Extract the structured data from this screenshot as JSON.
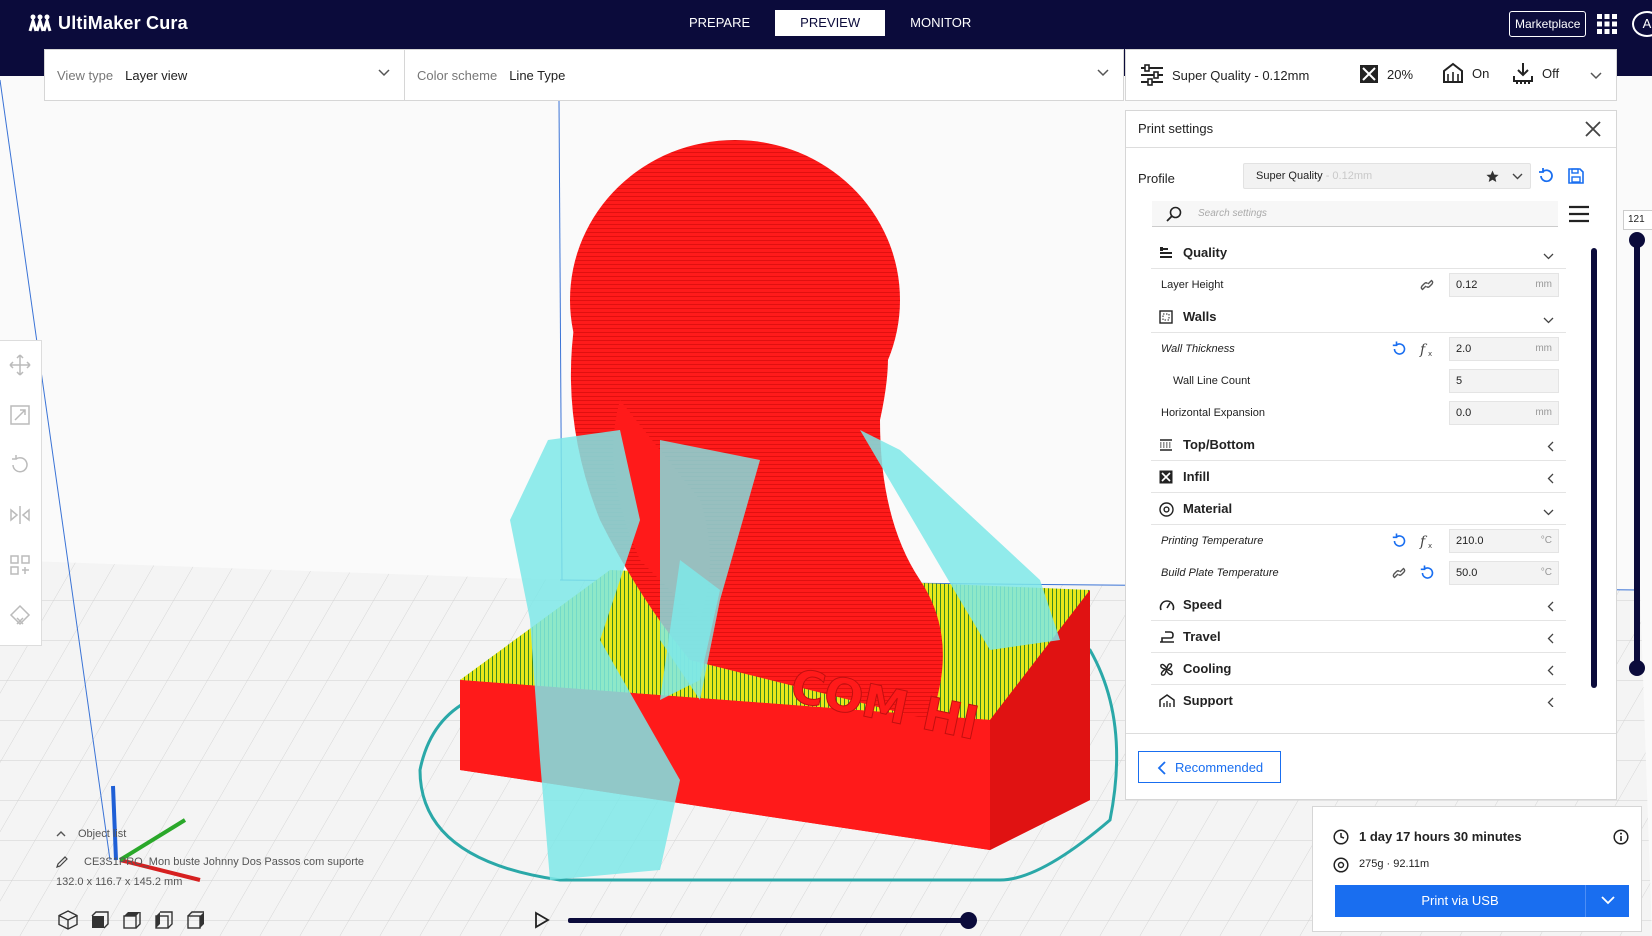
{
  "header": {
    "app_title": "UltiMaker Cura",
    "stages": [
      {
        "label": "PREPARE",
        "active": false
      },
      {
        "label": "PREVIEW",
        "active": true
      },
      {
        "label": "MONITOR",
        "active": false
      }
    ],
    "marketplace_label": "Marketplace",
    "account_initial": "A"
  },
  "viewbar": {
    "view_type_label": "View type",
    "view_type_value": "Layer view",
    "color_scheme_label": "Color scheme",
    "color_scheme_value": "Line Type"
  },
  "printbar": {
    "profile": "Super Quality - 0.12mm",
    "infill": "20%",
    "support": "On",
    "adhesion": "Off"
  },
  "objects": {
    "header": "Object list",
    "item_name": "CE3S1PRO_Mon buste Johnny Dos Passos com suporte",
    "dimensions": "132.0 x 116.7 x 145.2 mm"
  },
  "layer_slider": {
    "current_layer_label": "121"
  },
  "print_settings": {
    "title": "Print settings",
    "profile_label": "Profile",
    "profile_name": "Super Quality",
    "profile_suffix": " - 0.12mm",
    "search_placeholder": "Search settings",
    "rows": [
      {
        "kind": "category",
        "label": "Quality",
        "icon": "quality-icon",
        "expanded": true
      },
      {
        "kind": "setting",
        "label": "Layer Height",
        "value": "0.12",
        "unit": "mm",
        "italic": false,
        "indent": false,
        "icons": [
          "link-icon"
        ]
      },
      {
        "kind": "category",
        "label": "Walls",
        "icon": "walls-icon",
        "expanded": true
      },
      {
        "kind": "setting",
        "label": "Wall Thickness",
        "value": "2.0",
        "unit": "mm",
        "italic": true,
        "indent": false,
        "icons": [
          "function-icon",
          "reset-icon"
        ]
      },
      {
        "kind": "setting",
        "label": "Wall Line Count",
        "value": "5",
        "unit": "",
        "italic": false,
        "indent": true,
        "icons": []
      },
      {
        "kind": "setting",
        "label": "Horizontal Expansion",
        "value": "0.0",
        "unit": "mm",
        "italic": false,
        "indent": false,
        "icons": []
      },
      {
        "kind": "category",
        "label": "Top/Bottom",
        "icon": "top-bottom-icon",
        "expanded": false
      },
      {
        "kind": "category",
        "label": "Infill",
        "icon": "infill-icon",
        "expanded": false
      },
      {
        "kind": "category",
        "label": "Material",
        "icon": "material-icon",
        "expanded": true
      },
      {
        "kind": "setting",
        "label": "Printing Temperature",
        "value": "210.0",
        "unit": "°C",
        "italic": true,
        "indent": false,
        "icons": [
          "function-icon",
          "reset-icon"
        ]
      },
      {
        "kind": "setting",
        "label": "Build Plate Temperature",
        "value": "50.0",
        "unit": "°C",
        "italic": true,
        "indent": false,
        "icons": [
          "reset-icon",
          "link-icon"
        ]
      },
      {
        "kind": "category",
        "label": "Speed",
        "icon": "speed-icon",
        "expanded": false
      },
      {
        "kind": "category",
        "label": "Travel",
        "icon": "travel-icon",
        "expanded": false
      },
      {
        "kind": "category",
        "label": "Cooling",
        "icon": "cooling-icon",
        "expanded": false
      },
      {
        "kind": "category",
        "label": "Support",
        "icon": "support-icon",
        "expanded": false
      }
    ],
    "recommended_label": "Recommended"
  },
  "estimate": {
    "time": "1 day 17 hours 30 minutes",
    "material": "275g · 92.11m",
    "print_button_label": "Print via USB"
  },
  "colors": {
    "header_bg": "#0b0b3b",
    "accent": "#196ef0",
    "model_red": "#ff1a1a",
    "support_cyan": "#7ee8e8",
    "infill_yellow": "#e8e81a",
    "skirt_teal": "#2aa8a8"
  }
}
